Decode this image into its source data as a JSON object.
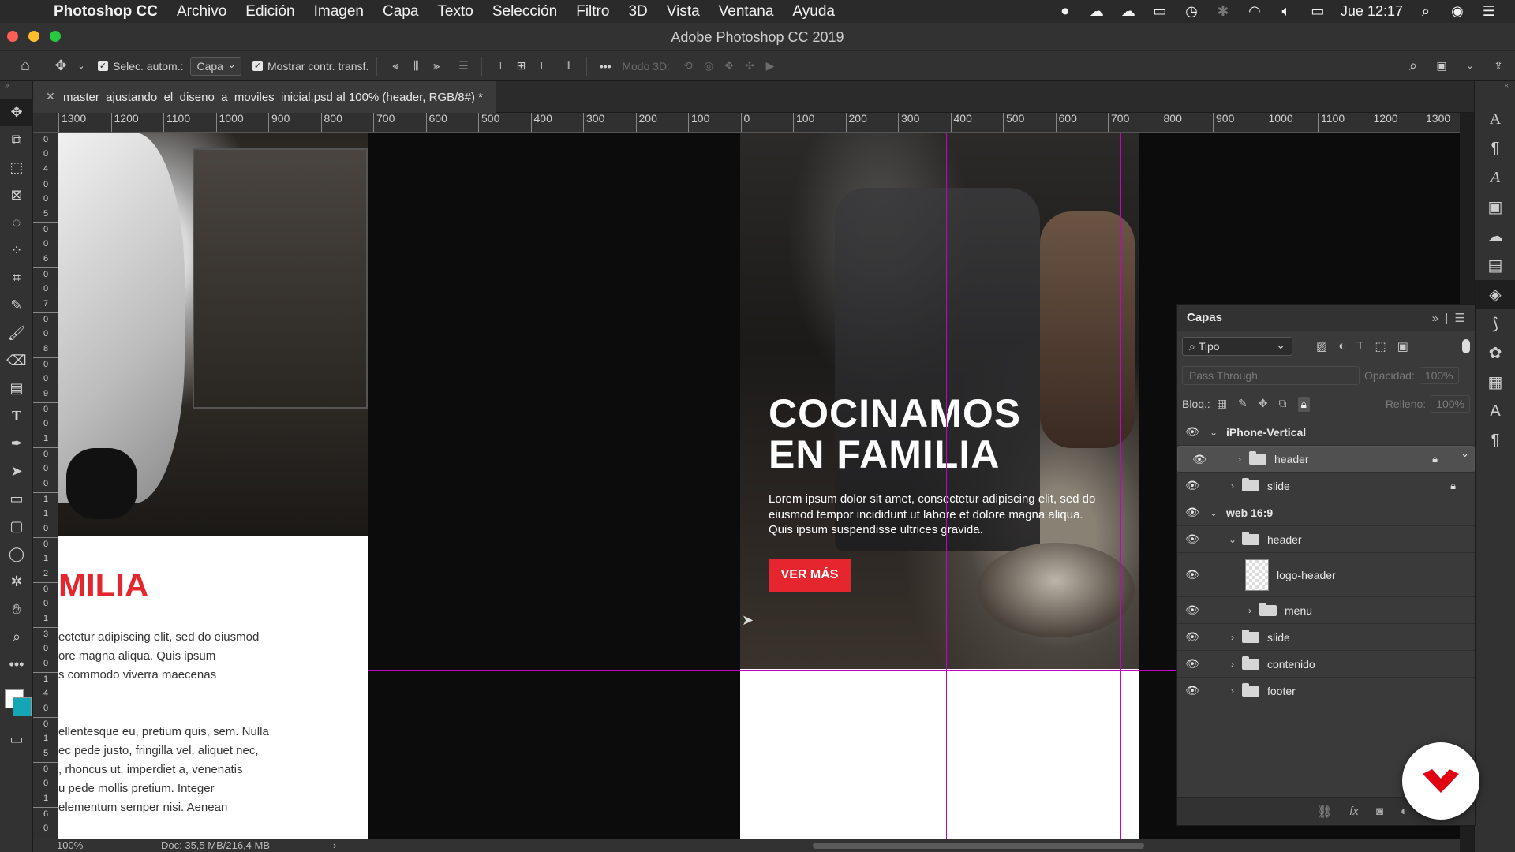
{
  "menubar": {
    "app_name": "Photoshop CC",
    "items": [
      "Archivo",
      "Edición",
      "Imagen",
      "Capa",
      "Texto",
      "Selección",
      "Filtro",
      "3D",
      "Vista",
      "Ventana",
      "Ayuda"
    ],
    "clock": "Jue 12:17"
  },
  "window": {
    "title": "Adobe Photoshop CC 2019"
  },
  "options": {
    "auto_select_label": "Selec. autom.:",
    "auto_select_value": "Capa",
    "show_transform_label": "Mostrar contr. transf.",
    "mode3d_label": "Modo 3D:"
  },
  "document": {
    "tab_title": "master_ajustando_el_diseno_a_moviles_inicial.psd al 100% (header, RGB/8#) *"
  },
  "rulers": {
    "h_labels": [
      "1300",
      "1200",
      "1100",
      "1000",
      "900",
      "800",
      "700",
      "600",
      "500",
      "400",
      "300",
      "200",
      "100",
      "0",
      "100",
      "200",
      "300",
      "400",
      "500",
      "600",
      "700",
      "800",
      "900",
      "1000",
      "1100",
      "1200",
      "1300"
    ],
    "v_labels": [
      "0",
      "0",
      "4",
      "0",
      "0",
      "5",
      "0",
      "0",
      "6",
      "0",
      "0",
      "7",
      "0",
      "0",
      "8",
      "0",
      "0",
      "9",
      "0",
      "0",
      "1",
      "0",
      "0",
      "0",
      "1",
      "1",
      "0",
      "0",
      "1",
      "2",
      "0",
      "0",
      "1",
      "3",
      "0",
      "0",
      "1",
      "4",
      "0",
      "0",
      "1",
      "5",
      "0",
      "0",
      "1",
      "6",
      "0"
    ]
  },
  "artboard_left": {
    "heading_fragment": "MILIA",
    "paragraphs": [
      "ectetur adipiscing elit, sed do eiusmod",
      "ore magna aliqua. Quis ipsum",
      "s commodo viverra maecenas",
      "ellentesque eu, pretium quis, sem. Nulla",
      "ec pede justo, fringilla vel, aliquet nec,",
      ", rhoncus ut, imperdiet a, venenatis",
      "u pede mollis pretium. Integer",
      "elementum semper nisi. Aenean"
    ]
  },
  "artboard_right": {
    "title_line1": "COCINAMOS",
    "title_line2": "EN FAMILIA",
    "body": "Lorem ipsum dolor sit amet, consectetur adipiscing elit, sed do eiusmod tempor incididunt ut labore et dolore magna aliqua. Quis ipsum suspendisse ultrices gravida.",
    "cta": "VER MÁS"
  },
  "status": {
    "zoom": "100%",
    "doc_size": "Doc: 35,5 MB/216,4 MB"
  },
  "layers_panel": {
    "title": "Capas",
    "filter_label": "Tipo",
    "blend_mode": "Pass Through",
    "opacity_label": "Opacidad:",
    "opacity_value": "100%",
    "lock_label": "Bloq.:",
    "fill_label": "Relleno:",
    "fill_value": "100%",
    "layers": [
      {
        "name": "iPhone-Vertical",
        "type": "artboard",
        "expanded": true,
        "indent": 0
      },
      {
        "name": "header",
        "type": "group",
        "locked": true,
        "selected": true,
        "indent": 1
      },
      {
        "name": "slide",
        "type": "group",
        "locked": true,
        "indent": 1
      },
      {
        "name": "web 16:9",
        "type": "artboard",
        "expanded": true,
        "indent": 0
      },
      {
        "name": "header",
        "type": "group",
        "expanded": true,
        "indent": 1
      },
      {
        "name": "logo-header",
        "type": "smart-object",
        "indent": 2
      },
      {
        "name": "menu",
        "type": "group",
        "indent": 2
      },
      {
        "name": "slide",
        "type": "group",
        "indent": 1
      },
      {
        "name": "contenido",
        "type": "group",
        "indent": 1
      },
      {
        "name": "footer",
        "type": "group",
        "indent": 1
      }
    ]
  },
  "colors": {
    "accent_red": "#e5262e",
    "guide_magenta": "#c800c8",
    "panel_bg": "#3a3a3a"
  }
}
